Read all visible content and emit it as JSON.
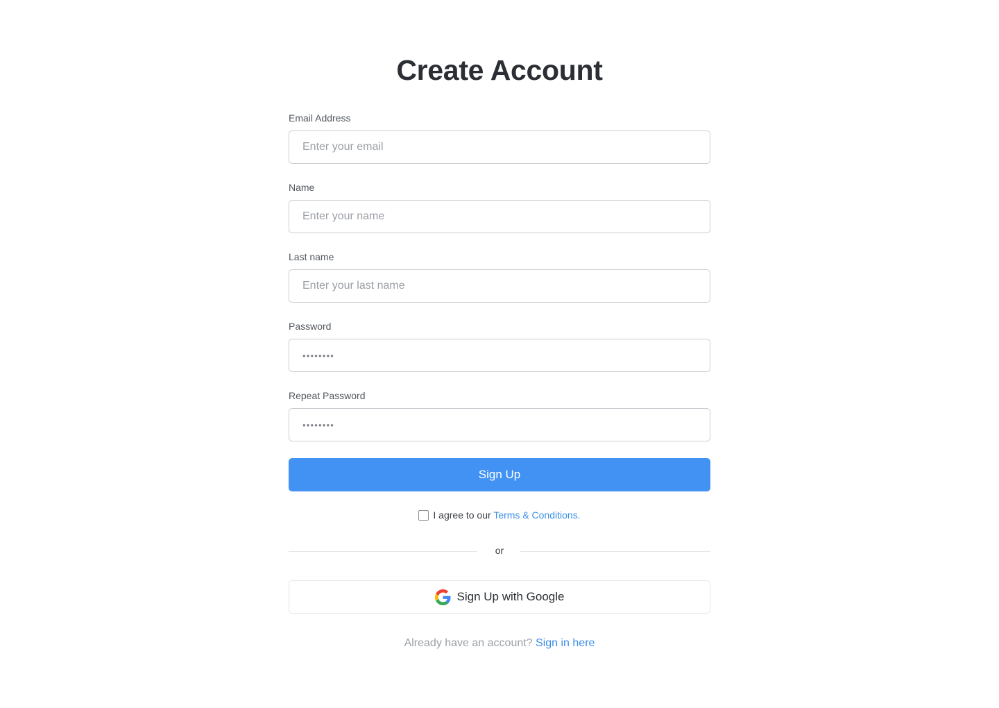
{
  "page_title": "Create Account",
  "fields": [
    {
      "label": "Email Address",
      "placeholder": "Enter your email",
      "type": "email"
    },
    {
      "label": "Name",
      "placeholder": "Enter your name",
      "type": "text"
    },
    {
      "label": "Last name",
      "placeholder": "Enter your last name",
      "type": "text"
    },
    {
      "label": "Password",
      "masked_value": "••••••••",
      "type": "password"
    },
    {
      "label": "Repeat Password",
      "masked_value": "••••••••",
      "type": "password"
    }
  ],
  "signup_button": "Sign Up",
  "terms": {
    "prefix": "I agree to our",
    "link": "Terms & Conditions.",
    "checked": false
  },
  "divider_text": "or",
  "google_button": "Sign Up with Google",
  "signin": {
    "prompt": "Already have an account?",
    "link": "Sign in here"
  },
  "colors": {
    "primary": "#4292f4",
    "link": "#3a8ee6",
    "title": "#2b2e33"
  },
  "icons": [
    "google-icon",
    "checkbox"
  ]
}
